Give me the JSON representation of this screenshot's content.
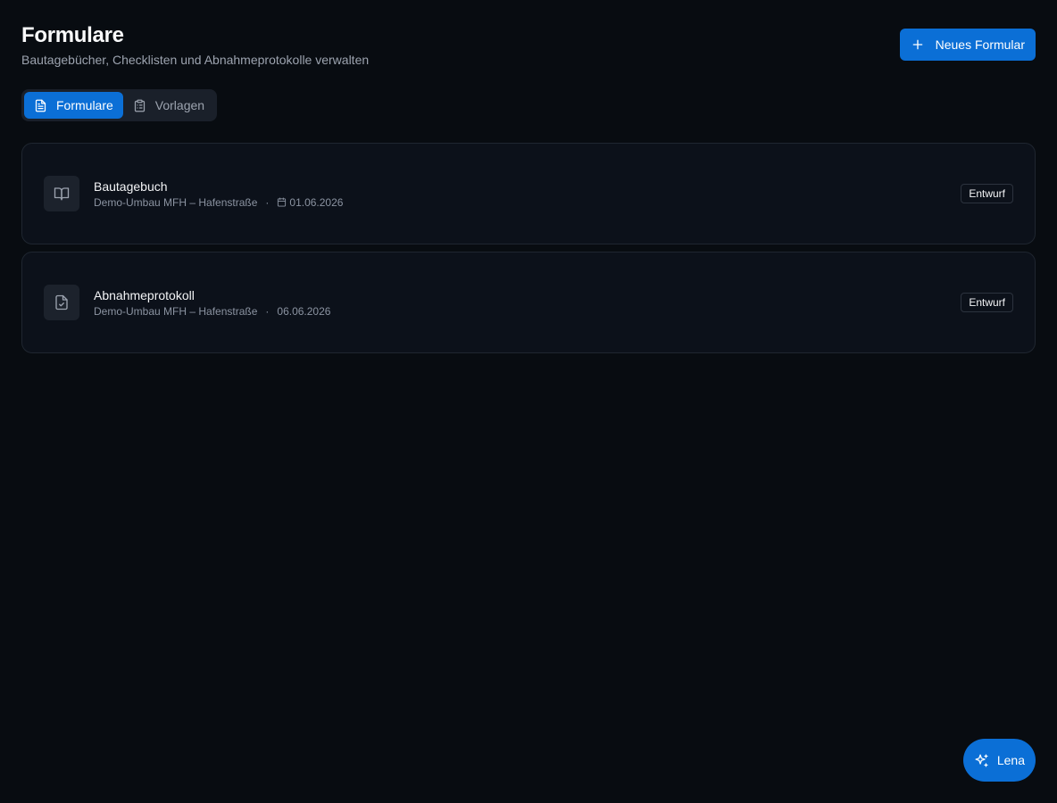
{
  "header": {
    "title": "Formulare",
    "subtitle": "Bautagebücher, Checklisten und Abnahmeprotokolle verwalten"
  },
  "actions": {
    "new_form_label": "Neues Formular"
  },
  "tabs": [
    {
      "label": "Formulare",
      "icon": "file-text-icon",
      "active": true
    },
    {
      "label": "Vorlagen",
      "icon": "clipboard-list-icon",
      "active": false
    }
  ],
  "forms": [
    {
      "title": "Bautagebuch",
      "project": "Demo-Umbau MFH – Hafenstraße",
      "separator": "·",
      "date": "01.06.2026",
      "status": "Entwurf",
      "icon": "book-open-icon"
    },
    {
      "title": "Abnahmeprotokoll",
      "project": "Demo-Umbau MFH – Hafenstraße",
      "separator": "·",
      "date": "06.06.2026",
      "status": "Entwurf",
      "icon": "file-check-icon"
    }
  ],
  "assistant": {
    "label": "Lena",
    "icon": "sparkles-icon"
  },
  "colors": {
    "background": "#080c11",
    "accent": "#0b6fd6",
    "card": "#0c111a",
    "border": "#1f2630"
  }
}
